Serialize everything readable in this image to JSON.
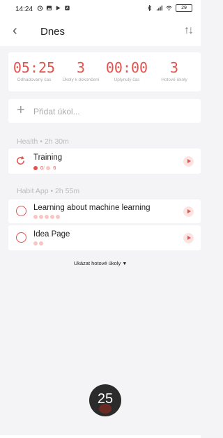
{
  "status_bar": {
    "time": "14:24",
    "battery": "29"
  },
  "app_bar": {
    "title": "Dnes"
  },
  "stats": [
    {
      "value": "05:25",
      "label": "Odhadovaný čas"
    },
    {
      "value": "3",
      "label": "Úkoly k dokončení"
    },
    {
      "value": "00:00",
      "label": "Uplynulý čas"
    },
    {
      "value": "3",
      "label": "Hotové úkoly"
    }
  ],
  "add_task": {
    "placeholder": "Přidat úkol..."
  },
  "sections": [
    {
      "header": "Health • 2h 30m",
      "tasks": [
        {
          "name": "Training",
          "done_pomodoros": "0",
          "estimated_pomodoros": "6",
          "repeat": true
        }
      ]
    },
    {
      "header": "Habit App • 2h 55m",
      "tasks": [
        {
          "name": "Learning about machine learning",
          "estimated_pomodoros": 5
        },
        {
          "name": "Idea Page",
          "estimated_pomodoros": 2
        }
      ]
    }
  ],
  "show_done_label": "Ukázat hotové úkoly",
  "timer_value": "25",
  "colors": {
    "accent": "#e8514a",
    "background": "#f4f4f6",
    "timer_bg": "#2b2b2b"
  },
  "icons": {
    "back": "chevron-left-icon",
    "sort": "sort-icon",
    "add": "plus-icon",
    "task": "circle-icon",
    "repeat": "refresh-icon",
    "play": "play-icon"
  }
}
